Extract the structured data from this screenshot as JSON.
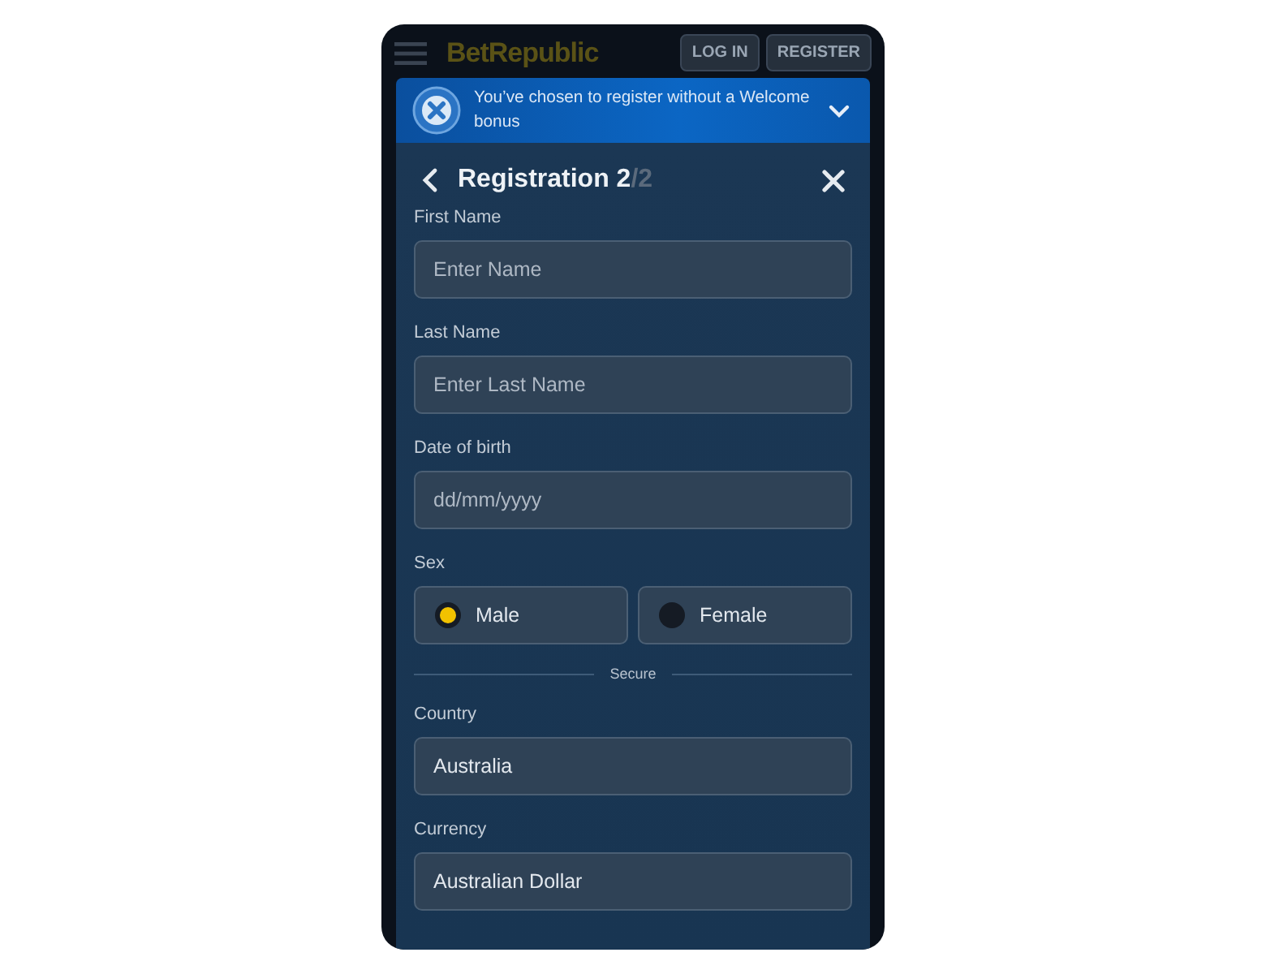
{
  "header": {
    "logo": "BetRepublic",
    "buttons": [
      "LOG IN",
      "REGISTER"
    ]
  },
  "banner": {
    "text": "You’ve chosen to register without a Welcome bonus",
    "expanded": false
  },
  "modal": {
    "title": "Registration 2",
    "step_total": "/2",
    "fields": [
      {
        "kind": "input",
        "label": "First Name",
        "placeholder": "Enter Name"
      },
      {
        "kind": "input",
        "label": "Last Name",
        "placeholder": "Enter Last Name"
      },
      {
        "kind": "input",
        "label": "Date of birth",
        "placeholder": "dd/mm/yyyy"
      },
      {
        "kind": "radio",
        "label": "Sex",
        "options": [
          {
            "label": "Male",
            "selected": true
          },
          {
            "label": "Female",
            "selected": false
          }
        ]
      },
      {
        "kind": "divider",
        "label": "Secure"
      },
      {
        "kind": "input",
        "label": "Country",
        "value": "Australia"
      },
      {
        "kind": "input",
        "label": "Currency",
        "value": "Australian Dollar"
      }
    ]
  }
}
